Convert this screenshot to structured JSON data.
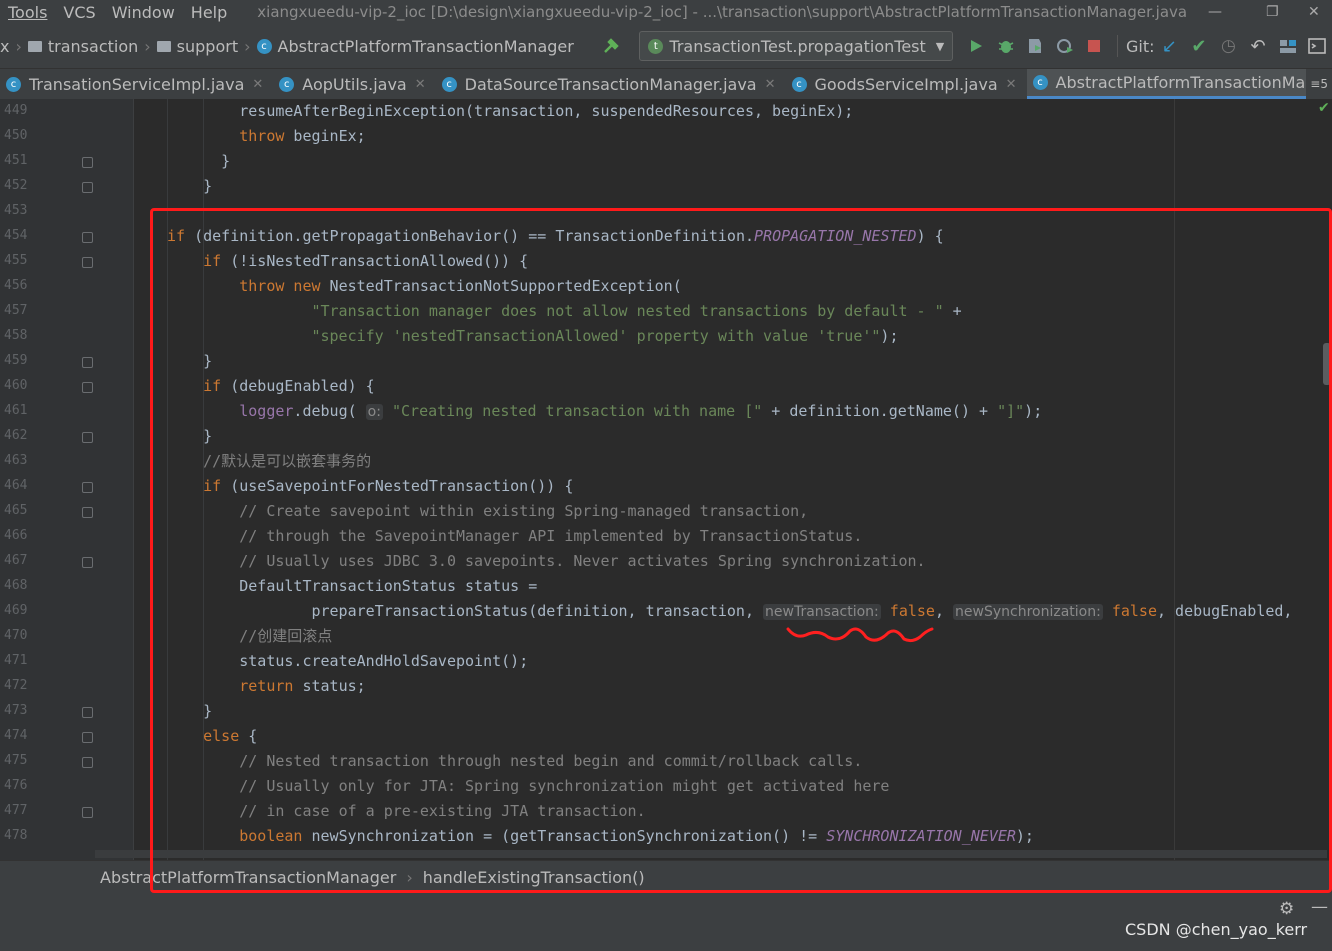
{
  "menu": {
    "items": [
      "Tools",
      "VCS",
      "Window",
      "Help"
    ],
    "window_title": "xiangxueedu-vip-2_ioc [D:\\design\\xiangxueedu-vip-2_ioc] - ...\\transaction\\support\\AbstractPlatformTransactionManager.java"
  },
  "nav": {
    "lead": "x",
    "crumbs": [
      "transaction",
      "support",
      "AbstractPlatformTransactionManager"
    ],
    "run_config": "TransactionTest.propagationTest",
    "git_label": "Git:"
  },
  "tabs": [
    {
      "label": "TransationServiceImpl.java",
      "active": false
    },
    {
      "label": "AopUtils.java",
      "active": false
    },
    {
      "label": "DataSourceTransactionManager.java",
      "active": false
    },
    {
      "label": "GoodsServiceImpl.java",
      "active": false
    },
    {
      "label": "AbstractPlatformTransactionManager.java",
      "active": true
    }
  ],
  "tabs_overflow": "≡5",
  "colors": {
    "keyword": "#cc7832",
    "string": "#6a8759",
    "comment": "#808080",
    "field": "#9876aa",
    "highlight": "#ff1a1a"
  },
  "code_lines": [
    {
      "n": "449",
      "ind": 8,
      "fold": false,
      "tokens": [
        [
          "",
          "resumeAfterBeginException(transaction, suspendedResources, beginEx);"
        ]
      ]
    },
    {
      "n": "450",
      "ind": 8,
      "fold": false,
      "tokens": [
        [
          "kw",
          "throw"
        ],
        [
          "",
          " beginEx;"
        ]
      ]
    },
    {
      "n": "451",
      "ind": 6,
      "fold": true,
      "tokens": [
        [
          "",
          "}"
        ]
      ]
    },
    {
      "n": "452",
      "ind": 4,
      "fold": true,
      "tokens": [
        [
          "",
          "}"
        ]
      ]
    },
    {
      "n": "453",
      "ind": 0,
      "fold": false,
      "tokens": []
    },
    {
      "n": "454",
      "ind": 0,
      "fold": true,
      "tokens": [
        [
          "kw",
          "if"
        ],
        [
          "",
          " (definition.getPropagationBehavior() == TransactionDefinition."
        ],
        [
          "fld",
          "PROPAGATION_NESTED"
        ],
        [
          "",
          ") {"
        ]
      ]
    },
    {
      "n": "455",
      "ind": 4,
      "fold": true,
      "tokens": [
        [
          "kw",
          "if"
        ],
        [
          "",
          " (!isNestedTransactionAllowed()) {"
        ]
      ]
    },
    {
      "n": "456",
      "ind": 8,
      "fold": false,
      "tokens": [
        [
          "kw",
          "throw new"
        ],
        [
          "",
          " NestedTransactionNotSupportedException("
        ]
      ]
    },
    {
      "n": "457",
      "ind": 16,
      "fold": false,
      "tokens": [
        [
          "str",
          "\"Transaction manager does not allow nested transactions by default - \""
        ],
        [
          "",
          " +"
        ]
      ]
    },
    {
      "n": "458",
      "ind": 16,
      "fold": false,
      "tokens": [
        [
          "str",
          "\"specify 'nestedTransactionAllowed' property with value 'true'\""
        ],
        [
          "",
          ");"
        ]
      ]
    },
    {
      "n": "459",
      "ind": 4,
      "fold": true,
      "tokens": [
        [
          "",
          "}"
        ]
      ]
    },
    {
      "n": "460",
      "ind": 4,
      "fold": true,
      "tokens": [
        [
          "kw",
          "if"
        ],
        [
          "",
          " (debugEnabled) {"
        ]
      ]
    },
    {
      "n": "461",
      "ind": 8,
      "fold": false,
      "tokens": [
        [
          "lg",
          "logger"
        ],
        [
          "",
          ".debug( "
        ],
        [
          "hint",
          "o:"
        ],
        [
          "",
          " "
        ],
        [
          "str",
          "\"Creating nested transaction with name [\""
        ],
        [
          "",
          " + definition.getName() + "
        ],
        [
          "str",
          "\"]\""
        ],
        [
          "",
          ");"
        ]
      ]
    },
    {
      "n": "462",
      "ind": 4,
      "fold": true,
      "tokens": [
        [
          "",
          "}"
        ]
      ]
    },
    {
      "n": "463",
      "ind": 4,
      "fold": false,
      "tokens": [
        [
          "cmt",
          "//默认是可以嵌套事务的"
        ]
      ]
    },
    {
      "n": "464",
      "ind": 4,
      "fold": true,
      "tokens": [
        [
          "kw",
          "if"
        ],
        [
          "",
          " (useSavepointForNestedTransaction()) {"
        ]
      ]
    },
    {
      "n": "465",
      "ind": 8,
      "fold": true,
      "tokens": [
        [
          "cmt",
          "// Create savepoint within existing Spring-managed transaction,"
        ]
      ]
    },
    {
      "n": "466",
      "ind": 8,
      "fold": false,
      "tokens": [
        [
          "cmt",
          "// through the SavepointManager API implemented by TransactionStatus."
        ]
      ]
    },
    {
      "n": "467",
      "ind": 8,
      "fold": true,
      "tokens": [
        [
          "cmt",
          "// Usually uses JDBC 3.0 savepoints. Never activates Spring synchronization."
        ]
      ]
    },
    {
      "n": "468",
      "ind": 8,
      "fold": false,
      "tokens": [
        [
          "",
          "DefaultTransactionStatus status ="
        ]
      ]
    },
    {
      "n": "469",
      "ind": 16,
      "fold": false,
      "tokens": [
        [
          "",
          "prepareTransactionStatus(definition, transaction, "
        ],
        [
          "hint",
          "newTransaction:"
        ],
        [
          "",
          " "
        ],
        [
          "kw",
          "false"
        ],
        [
          "",
          ", "
        ],
        [
          "hint",
          "newSynchronization:"
        ],
        [
          "",
          " "
        ],
        [
          "kw",
          "false"
        ],
        [
          "",
          ", debugEnabled, "
        ]
      ]
    },
    {
      "n": "470",
      "ind": 8,
      "fold": false,
      "tokens": [
        [
          "cmt",
          "//创建回滚点"
        ]
      ]
    },
    {
      "n": "471",
      "ind": 8,
      "fold": false,
      "tokens": [
        [
          "",
          "status.createAndHoldSavepoint();"
        ]
      ]
    },
    {
      "n": "472",
      "ind": 8,
      "fold": false,
      "tokens": [
        [
          "kw",
          "return"
        ],
        [
          "",
          " status;"
        ]
      ]
    },
    {
      "n": "473",
      "ind": 4,
      "fold": true,
      "tokens": [
        [
          "",
          "}"
        ]
      ]
    },
    {
      "n": "474",
      "ind": 4,
      "fold": true,
      "tokens": [
        [
          "kw",
          "else"
        ],
        [
          "",
          " {"
        ]
      ]
    },
    {
      "n": "475",
      "ind": 8,
      "fold": true,
      "tokens": [
        [
          "cmt",
          "// Nested transaction through nested begin and commit/rollback calls."
        ]
      ]
    },
    {
      "n": "476",
      "ind": 8,
      "fold": false,
      "tokens": [
        [
          "cmt",
          "// Usually only for JTA: Spring synchronization might get activated here"
        ]
      ]
    },
    {
      "n": "477",
      "ind": 8,
      "fold": true,
      "tokens": [
        [
          "cmt",
          "// in case of a pre-existing JTA transaction."
        ]
      ]
    },
    {
      "n": "478",
      "ind": 8,
      "fold": false,
      "tokens": [
        [
          "kw",
          "boolean"
        ],
        [
          "",
          " newSynchronization = (getTransactionSynchronization() != "
        ],
        [
          "fld",
          "SYNCHRONIZATION_NEVER"
        ],
        [
          "",
          ");"
        ]
      ]
    }
  ],
  "footer_crumbs": [
    "AbstractPlatformTransactionManager",
    "handleExistingTransaction()"
  ],
  "watermark": "CSDN @chen_yao_kerr"
}
